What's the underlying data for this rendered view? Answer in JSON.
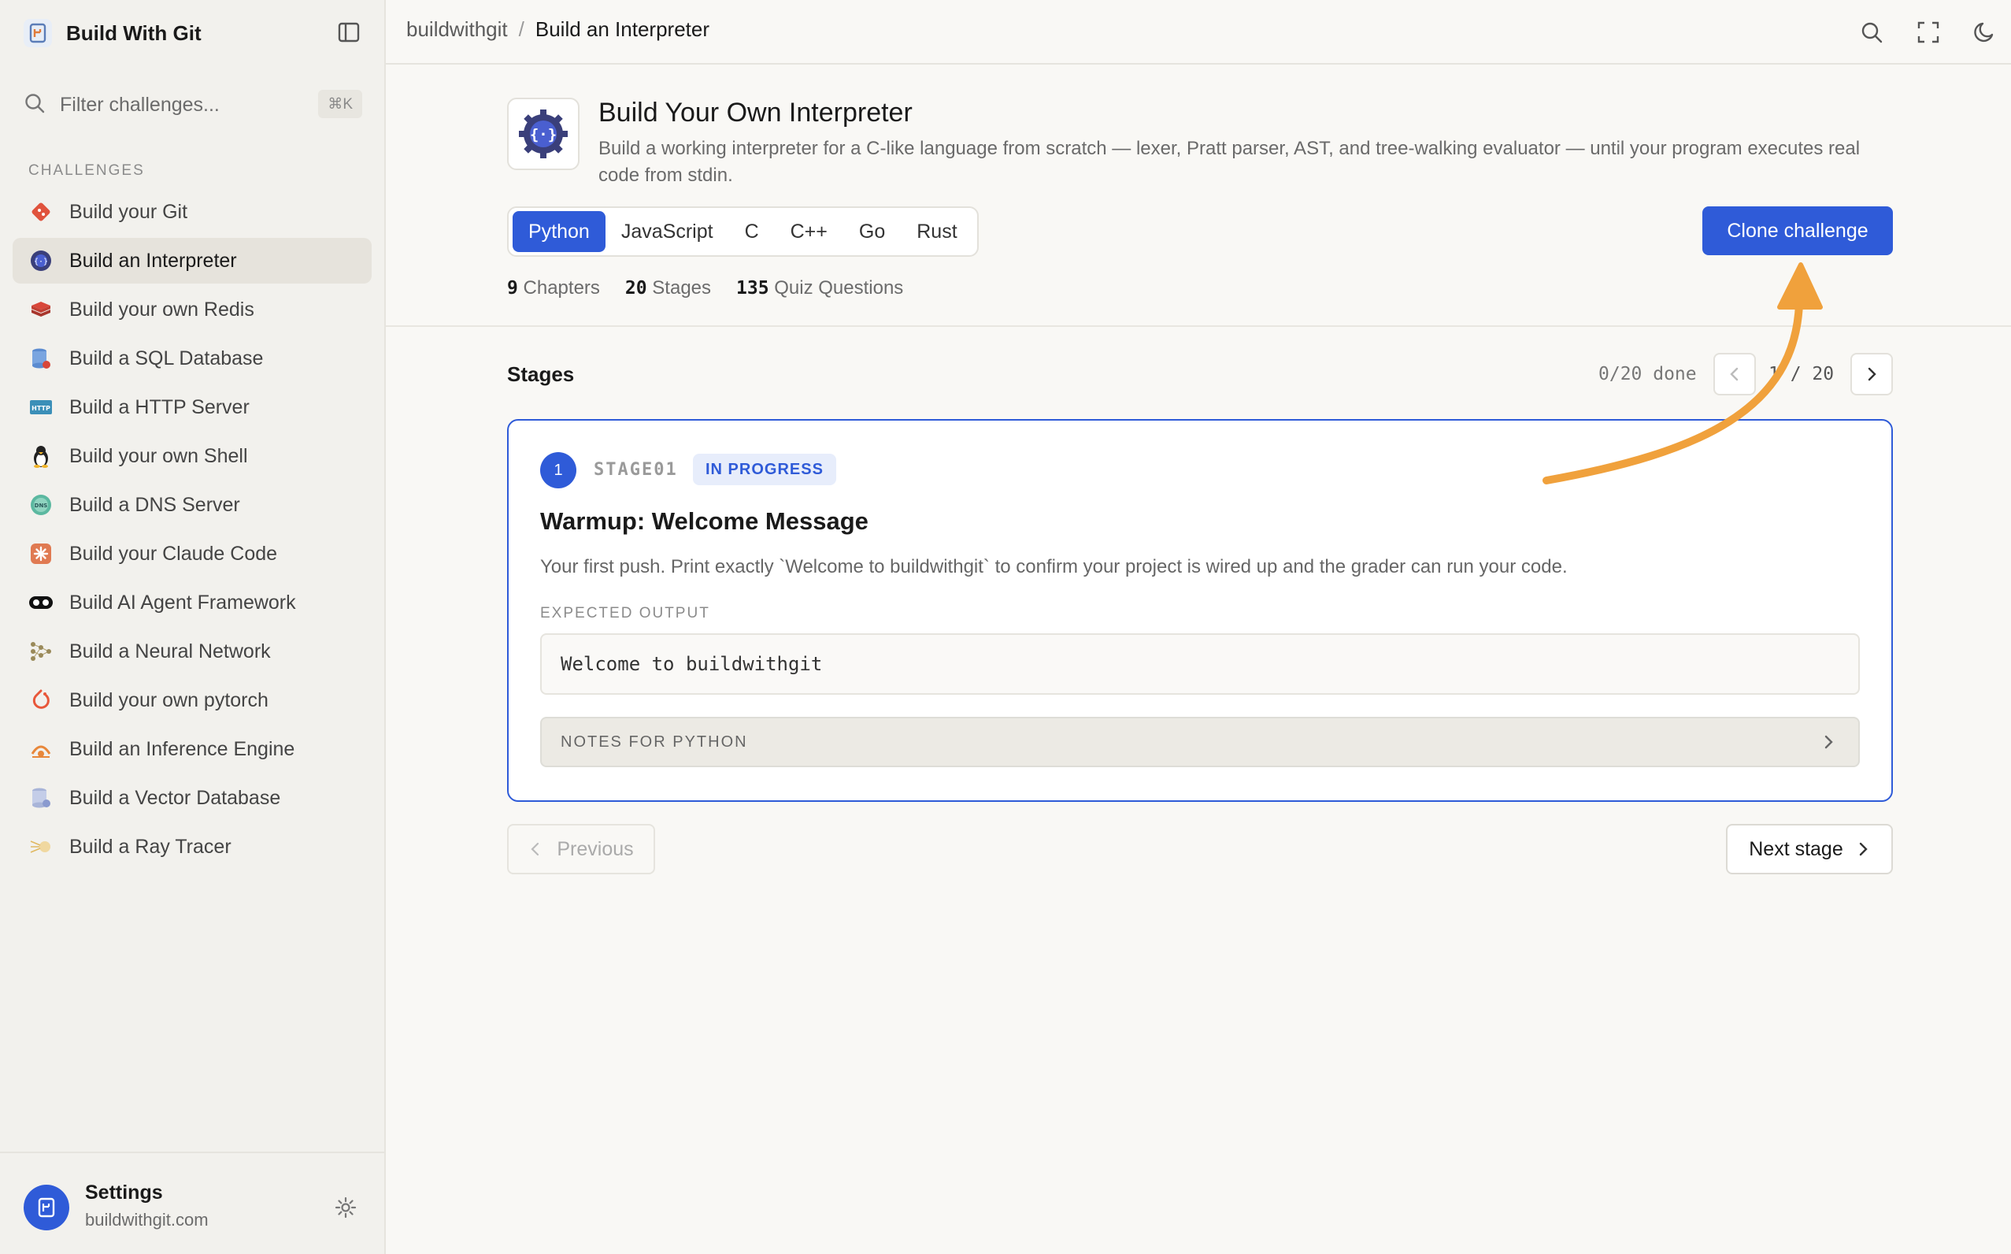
{
  "sidebar": {
    "brand": "Build With Git",
    "filter_placeholder": "Filter challenges...",
    "filter_shortcut": "⌘K",
    "section_label": "CHALLENGES",
    "items": [
      {
        "label": "Build your Git",
        "icon": "git-icon"
      },
      {
        "label": "Build an Interpreter",
        "icon": "interpreter-icon",
        "active": true
      },
      {
        "label": "Build your own Redis",
        "icon": "redis-icon"
      },
      {
        "label": "Build a SQL Database",
        "icon": "database-icon"
      },
      {
        "label": "Build a HTTP Server",
        "icon": "http-icon"
      },
      {
        "label": "Build your own Shell",
        "icon": "shell-penguin-icon"
      },
      {
        "label": "Build a DNS Server",
        "icon": "dns-icon"
      },
      {
        "label": "Build your Claude Code",
        "icon": "claude-icon"
      },
      {
        "label": "Build AI Agent Framework",
        "icon": "agent-icon"
      },
      {
        "label": "Build a Neural Network",
        "icon": "neural-network-icon"
      },
      {
        "label": "Build your own pytorch",
        "icon": "pytorch-icon"
      },
      {
        "label": "Build an Inference Engine",
        "icon": "inference-icon"
      },
      {
        "label": "Build a Vector Database",
        "icon": "vector-db-icon"
      },
      {
        "label": "Build a Ray Tracer",
        "icon": "ray-tracer-icon"
      }
    ],
    "footer": {
      "title": "Settings",
      "subtitle": "buildwithgit.com"
    }
  },
  "topbar": {
    "breadcrumb_root": "buildwithgit",
    "breadcrumb_separator": "/",
    "breadcrumb_current": "Build an Interpreter"
  },
  "challenge": {
    "title": "Build Your Own Interpreter",
    "description": "Build a working interpreter for a C-like language from scratch — lexer, Pratt parser, AST, and tree-walking evaluator — until your program executes real code from stdin.",
    "languages": [
      "Python",
      "JavaScript",
      "C",
      "C++",
      "Go",
      "Rust"
    ],
    "selected_language": "Python",
    "clone_label": "Clone challenge",
    "stats": {
      "chapters_num": "9",
      "chapters_label": "Chapters",
      "stages_num": "20",
      "stages_label": "Stages",
      "quiz_num": "135",
      "quiz_label": "Quiz Questions"
    }
  },
  "stages": {
    "title": "Stages",
    "done_text": "0/20 done",
    "pager_text": "1 / 20",
    "current": {
      "number": "1",
      "code": "STAGE01",
      "badge": "IN PROGRESS",
      "title": "Warmup: Welcome Message",
      "description": "Your first push. Print exactly `Welcome to buildwithgit` to confirm your project is wired up and the grader can run your code.",
      "expected_label": "EXPECTED OUTPUT",
      "expected_output": "Welcome to buildwithgit",
      "notes_label": "NOTES FOR PYTHON"
    },
    "prev_label": "Previous",
    "next_label": "Next stage"
  },
  "colors": {
    "accent": "#2f5bd8",
    "annotation_arrow": "#f0a13c"
  }
}
